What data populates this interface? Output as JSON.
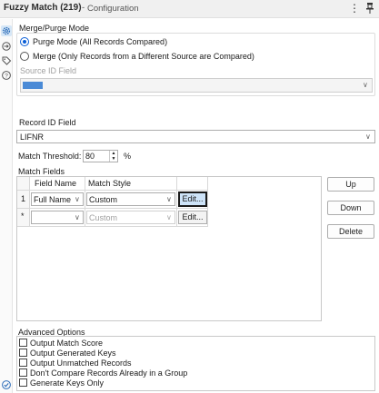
{
  "header": {
    "tool_name": "Fuzzy Match (219)",
    "separator": "-",
    "panel_label": "Configuration",
    "more_glyph": "⋮"
  },
  "sidebar": {
    "items": [
      {
        "icon": "gear-icon"
      },
      {
        "icon": "connection-icon"
      },
      {
        "icon": "tag-icon"
      },
      {
        "icon": "help-icon"
      }
    ],
    "bottom_icon": "check-circle-icon"
  },
  "merge_purge": {
    "heading": "Merge/Purge Mode",
    "purge_label": "Purge Mode (All Records Compared)",
    "merge_label": "Merge (Only Records from a Different Source are Compared)",
    "selected": "purge",
    "source_id_label": "Source ID Field"
  },
  "record_id": {
    "label": "Record ID Field",
    "value": "LIFNR"
  },
  "threshold": {
    "label": "Match Threshold:",
    "value": "80",
    "unit": "%"
  },
  "match_fields": {
    "heading": "Match Fields",
    "columns": [
      "Field Name",
      "Match Style"
    ],
    "rows": [
      {
        "index": "1",
        "field": "Full Name",
        "style": "Custom",
        "edit": "Edit..."
      },
      {
        "index": "*",
        "field": "",
        "style": "Custom",
        "edit": "Edit..."
      }
    ]
  },
  "buttons": {
    "up": "Up",
    "down": "Down",
    "delete": "Delete"
  },
  "advanced": {
    "heading": "Advanced Options",
    "options": [
      "Output Match Score",
      "Output Generated Keys",
      "Output Unmatched Records",
      "Don't Compare Records Already in a Group",
      "Generate Keys Only"
    ]
  },
  "colors": {
    "accent": "#0a5ed7",
    "selected_fill": "#cde3f8",
    "header_bg": "#f0f0f0"
  }
}
